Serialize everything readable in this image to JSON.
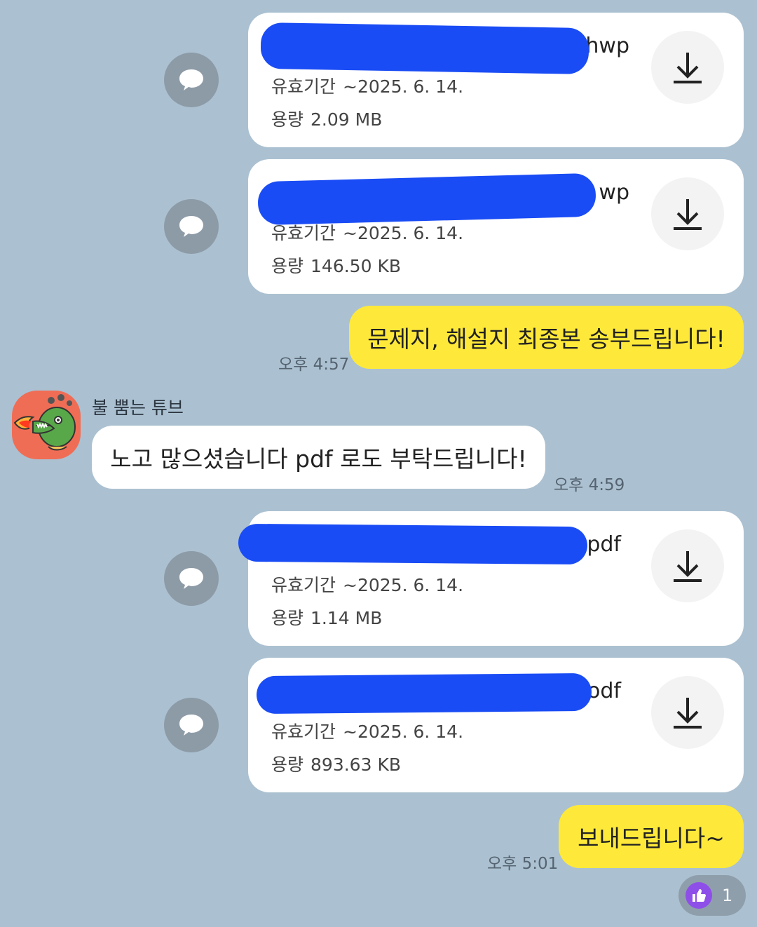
{
  "files": [
    {
      "name_suffix": "hwp",
      "expiry_label": "유효기간",
      "expiry": "~2025. 6. 14.",
      "size_label": "용량",
      "size": "2.09 MB"
    },
    {
      "name_suffix": "wp",
      "expiry_label": "유효기간",
      "expiry": "~2025. 6. 14.",
      "size_label": "용량",
      "size": "146.50 KB"
    },
    {
      "name_suffix": "pdf",
      "expiry_label": "유효기간",
      "expiry": "~2025. 6. 14.",
      "size_label": "용량",
      "size": "1.14 MB"
    },
    {
      "name_suffix": "odf",
      "expiry_label": "유효기간",
      "expiry": "~2025. 6. 14.",
      "size_label": "용량",
      "size": "893.63 KB"
    }
  ],
  "messages": {
    "mine_1": {
      "text": "문제지, 해설지 최종본 송부드립니다!",
      "time": "오후 4:57"
    },
    "other_1": {
      "sender": "불 뿜는 튜브",
      "text": "노고 많으셨습니다 pdf 로도 부탁드립니다!",
      "time": "오후 4:59"
    },
    "mine_2": {
      "text": "보내드립니다~",
      "time": "오후 5:01"
    }
  },
  "reaction": {
    "icon": "thumbs-up-icon",
    "count": "1"
  },
  "colors": {
    "background": "#abc1d1",
    "my_bubble": "#fee93a",
    "redaction": "#1a4cf5",
    "reaction_badge": "#8e4fe8"
  }
}
